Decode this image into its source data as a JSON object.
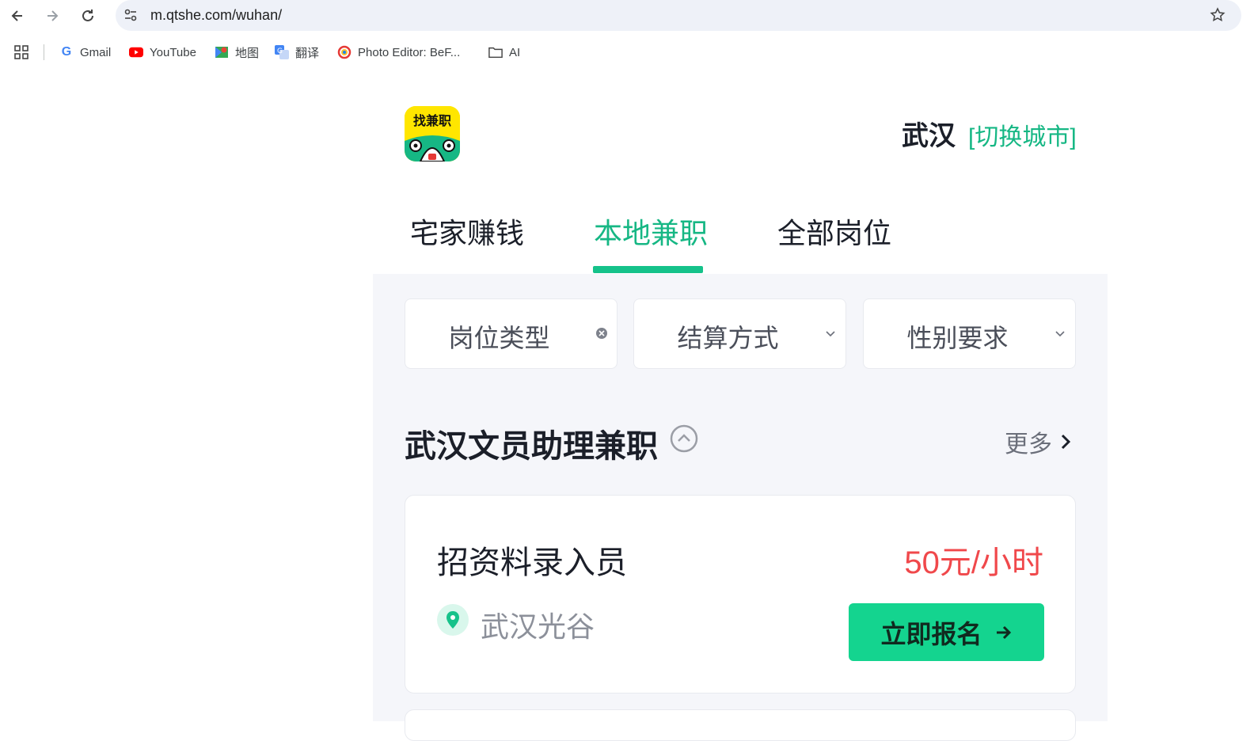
{
  "browser": {
    "url": "m.qtshe.com/wuhan/",
    "bookmarks": [
      {
        "label": "Gmail",
        "icon": "gmail-icon"
      },
      {
        "label": "YouTube",
        "icon": "youtube-icon"
      },
      {
        "label": "地图",
        "icon": "maps-icon"
      },
      {
        "label": "翻译",
        "icon": "translate-icon"
      },
      {
        "label": "Photo Editor: BeF...",
        "icon": "photo-editor-icon"
      },
      {
        "label": "AI",
        "icon": "folder-icon"
      }
    ]
  },
  "header": {
    "logo_text": "找兼职",
    "city": "武汉",
    "switch_city": "[切换城市]"
  },
  "tabs": [
    {
      "label": "宅家赚钱",
      "active": false
    },
    {
      "label": "本地兼职",
      "active": true
    },
    {
      "label": "全部岗位",
      "active": false
    }
  ],
  "filters": [
    {
      "label": "岗位类型",
      "icon": "clear-icon"
    },
    {
      "label": "结算方式",
      "icon": "chevron-down-icon"
    },
    {
      "label": "性别要求",
      "icon": "chevron-down-icon"
    }
  ],
  "section": {
    "title": "武汉文员助理兼职",
    "more_label": "更多"
  },
  "job": {
    "title": "招资料录入员",
    "salary": "50元/小时",
    "location": "武汉光谷",
    "apply_label": "立即报名"
  },
  "colors": {
    "accent": "#16b784",
    "button": "#14d48f",
    "salary": "#f0484b",
    "background": "#f5f6fa"
  }
}
